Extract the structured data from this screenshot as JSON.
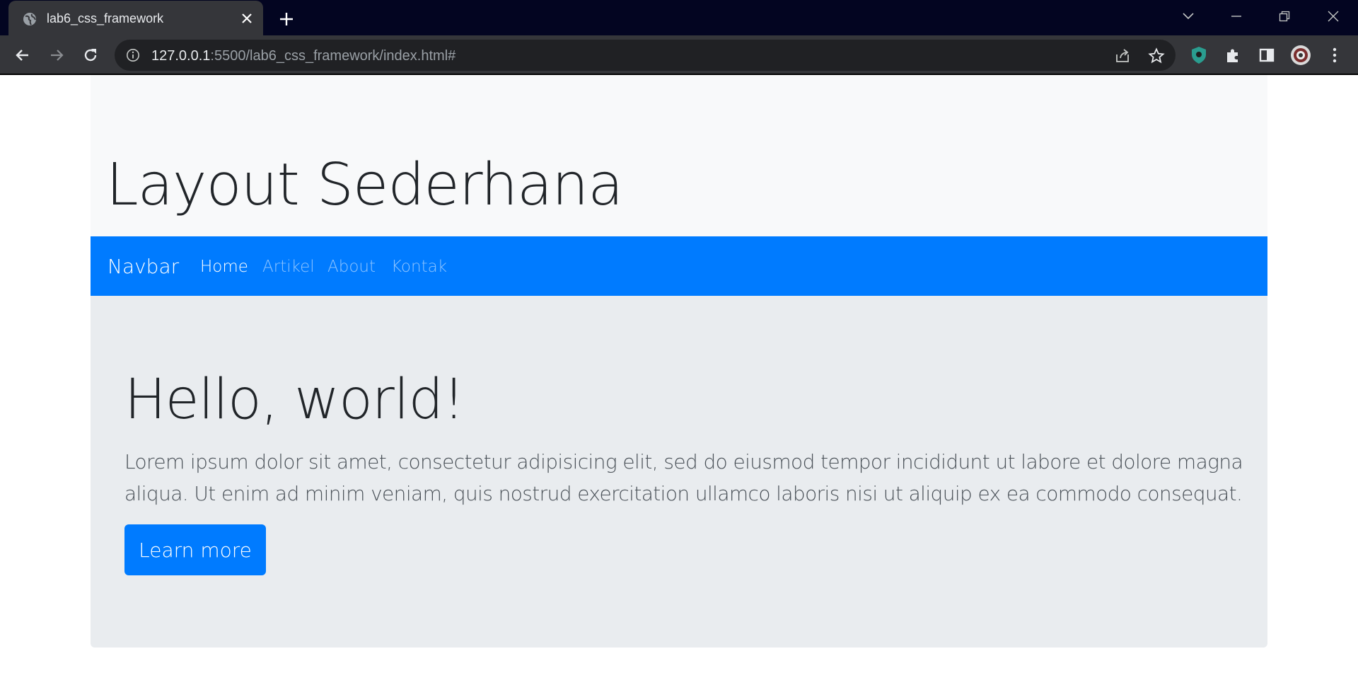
{
  "browser": {
    "tab_title": "lab6_css_framework",
    "url_host": "127.0.0.1",
    "url_rest": ":5500/lab6_css_framework/index.html#"
  },
  "page": {
    "header_title": "Layout Sederhana",
    "navbar": {
      "brand": "Navbar",
      "links": [
        {
          "label": "Home",
          "active": true
        },
        {
          "label": "Artikel",
          "active": false
        },
        {
          "label": "About",
          "active": false
        },
        {
          "label": "Kontak",
          "active": false
        }
      ]
    },
    "jumbotron": {
      "title": "Hello, world!",
      "lead": "Lorem ipsum dolor sit amet, consectetur adipisicing elit, sed do eiusmod tempor incididunt ut labore et dolore magna aliqua. Ut enim ad minim veniam, quis nostrud exercitation ullamco laboris nisi ut aliquip ex ea commodo consequat.",
      "button_label": "Learn more"
    }
  },
  "colors": {
    "chrome_dark": "#030521",
    "toolbar": "#35363a",
    "primary": "#007bff",
    "header_bg": "#f8f9fa",
    "jumbotron_bg": "#e9ecef"
  }
}
